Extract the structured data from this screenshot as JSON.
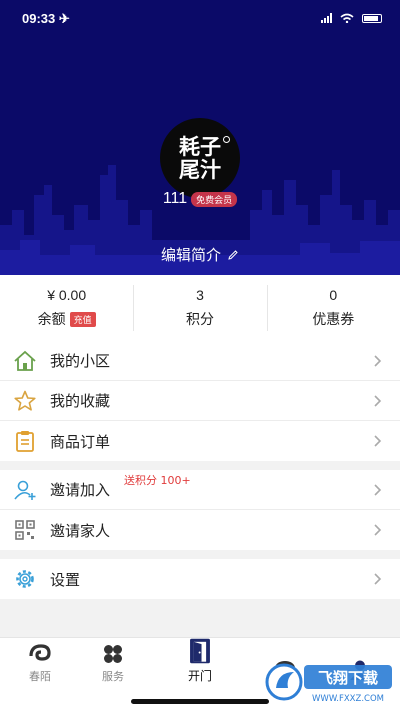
{
  "status_bar": {
    "time": "09:33 ✈"
  },
  "profile": {
    "avatar_text": "耗子尾汁",
    "username": "111",
    "member_badge": "免费会员",
    "edit_label": "编辑简介"
  },
  "stats": [
    {
      "value": "¥ 0.00",
      "label": "余额",
      "badge": "充值"
    },
    {
      "value": "3",
      "label": "积分"
    },
    {
      "value": "0",
      "label": "优惠券"
    }
  ],
  "menu": {
    "group1": [
      {
        "label": "我的小区",
        "icon": "house-icon"
      },
      {
        "label": "我的收藏",
        "icon": "star-icon"
      },
      {
        "label": "商品订单",
        "icon": "clipboard-icon"
      }
    ],
    "group2": [
      {
        "label": "邀请加入",
        "icon": "add-user-icon",
        "tag": "送积分 100+"
      },
      {
        "label": "邀请家人",
        "icon": "qr-code-icon"
      }
    ],
    "group3": [
      {
        "label": "设置",
        "icon": "gear-icon"
      }
    ]
  },
  "tabbar": [
    {
      "label": "春陌",
      "icon": "swirl-icon"
    },
    {
      "label": "服务",
      "icon": "clover-icon"
    },
    {
      "label": "开门",
      "icon": "door-icon",
      "active": true
    },
    {
      "label": "",
      "icon": "chat-icon"
    },
    {
      "label": "",
      "icon": "user-icon"
    }
  ],
  "watermark": {
    "text": "飞翔下载",
    "url": "WWW.FXXZ.COM"
  },
  "colors": {
    "header_bg": "#0b0a68",
    "badge_red": "#c4344a",
    "accent_blue": "#1f2a6b"
  }
}
